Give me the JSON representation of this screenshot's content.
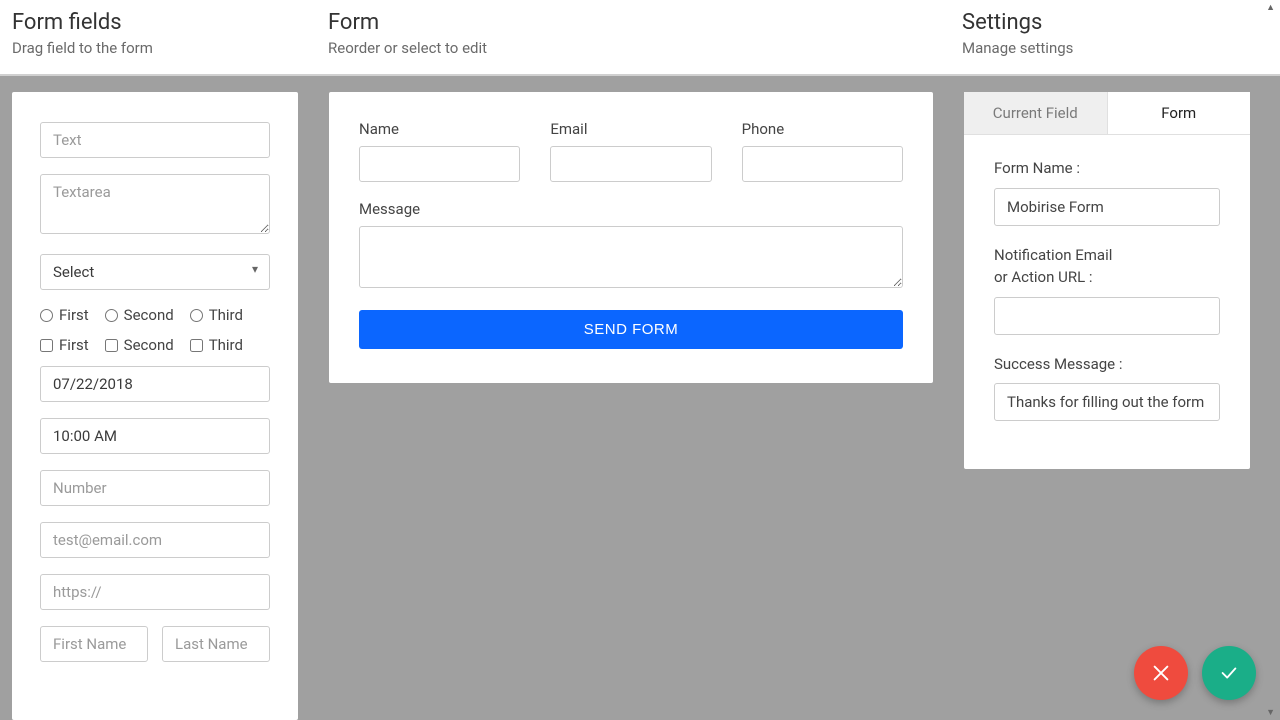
{
  "header": {
    "left": {
      "title": "Form fields",
      "sub": "Drag field to the form"
    },
    "center": {
      "title": "Form",
      "sub": "Reorder or select to edit"
    },
    "right": {
      "title": "Settings",
      "sub": "Manage settings"
    }
  },
  "fields": {
    "text_ph": "Text",
    "textarea_ph": "Textarea",
    "select_label": "Select",
    "radio": [
      "First",
      "Second",
      "Third"
    ],
    "checkbox": [
      "First",
      "Second",
      "Third"
    ],
    "date": "07/22/2018",
    "time": "10:00 AM",
    "number_ph": "Number",
    "email_ph": "test@email.com",
    "url_ph": "https://",
    "firstname_ph": "First Name",
    "lastname_ph": "Last Name"
  },
  "form": {
    "name_label": "Name",
    "email_label": "Email",
    "phone_label": "Phone",
    "message_label": "Message",
    "submit": "SEND FORM"
  },
  "settings": {
    "tab_current": "Current Field",
    "tab_form": "Form",
    "form_name_label": "Form Name :",
    "form_name_value": "Mobirise Form",
    "notif_label_1": "Notification Email",
    "notif_label_2": "or Action URL :",
    "notif_value": "",
    "success_label": "Success Message :",
    "success_value": "Thanks for filling out the form"
  }
}
